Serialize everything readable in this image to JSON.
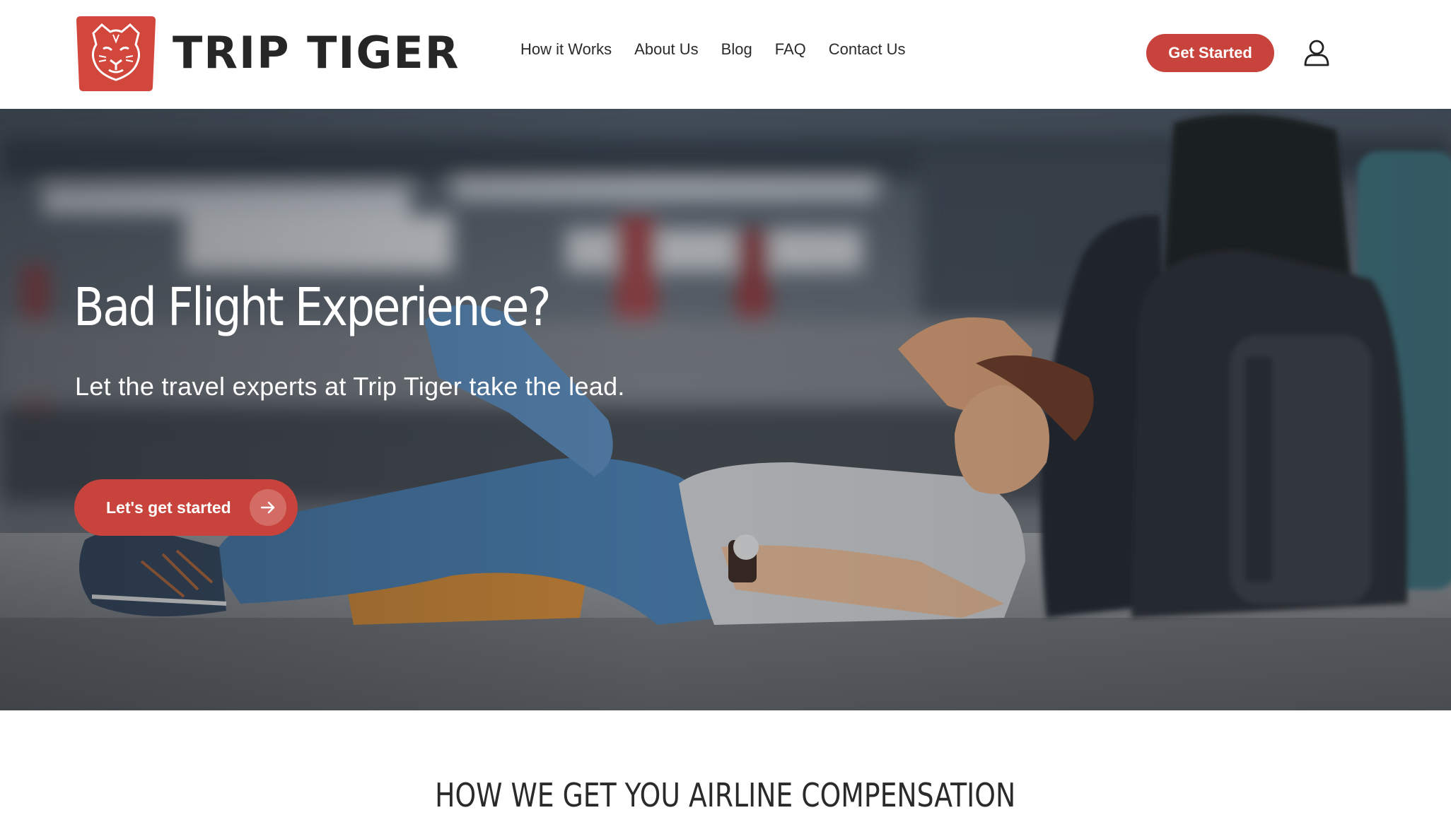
{
  "brand": {
    "name": "TRIP TIGER",
    "color": "#c8433b"
  },
  "nav": {
    "items": [
      {
        "label": "How it Works"
      },
      {
        "label": "About Us"
      },
      {
        "label": "Blog"
      },
      {
        "label": "FAQ"
      },
      {
        "label": "Contact Us"
      }
    ],
    "cta_label": "Get Started",
    "account_icon": "user-icon"
  },
  "hero": {
    "title": "Bad Flight Experience?",
    "subtitle": "Let the travel experts at Trip Tiger take the lead.",
    "cta_label": "Let's get started",
    "cta_icon": "arrow-right-icon"
  },
  "section": {
    "heading": "HOW WE GET YOU AIRLINE COMPENSATION"
  }
}
